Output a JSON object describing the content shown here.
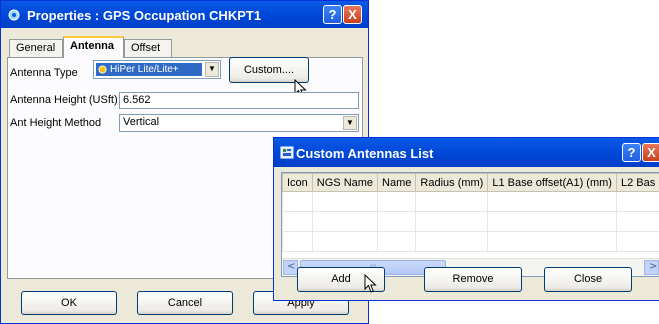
{
  "properties_window": {
    "title": "Properties : GPS Occupation CHKPT1",
    "tabs": [
      "General",
      "Antenna",
      "Offset"
    ],
    "active_tab": "Antenna",
    "antenna_type_label": "Antenna Type",
    "antenna_type_value": "HiPer Lite/Lite+",
    "custom_button": "Custom....",
    "antenna_height_label": "Antenna Height (USft)",
    "antenna_height_value": "6.562",
    "ant_height_method_label": "Ant Height Method",
    "ant_height_method_value": "Vertical",
    "ok_button": "OK",
    "cancel_button": "Cancel",
    "apply_button": "Apply",
    "help_glyph": "?",
    "close_glyph": "X"
  },
  "custom_list_window": {
    "title": "Custom Antennas List",
    "columns": [
      "Icon",
      "NGS Name",
      "Name",
      "Radius (mm)",
      "L1 Base offset(A1) (mm)",
      "L2 Bas"
    ],
    "add_button": "Add",
    "remove_button": "Remove",
    "close_button": "Close",
    "scroll_grip": "III",
    "help_glyph": "?",
    "close_glyph": "X"
  },
  "colors": {
    "title_bar": "#0a5ae6",
    "window_face": "#ece9d8",
    "selection": "#316ac5"
  }
}
